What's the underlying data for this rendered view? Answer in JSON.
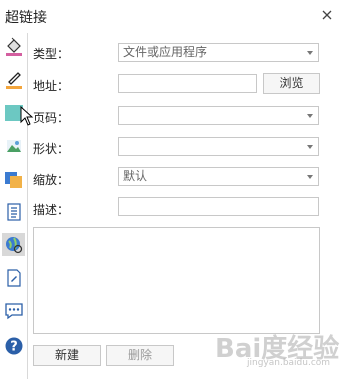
{
  "dialog": {
    "title": "超链接"
  },
  "form": {
    "type_label": "类型：",
    "type_value": "文件或应用程序",
    "address_label": "地址：",
    "address_value": "",
    "browse_label": "浏览",
    "page_label": "页码：",
    "page_value": "",
    "shape_label": "形状：",
    "shape_value": "",
    "zoom_label": "缩放：",
    "zoom_value": "默认",
    "desc_label": "描述：",
    "desc_value": ""
  },
  "buttons": {
    "new_label": "新建",
    "delete_label": "删除"
  },
  "watermark": {
    "text": "Bai度经验",
    "sub": "jingyan.baidu.com"
  },
  "sidebar": {
    "icons": [
      "paint-bucket-icon",
      "pen-line-icon",
      "square-fill-icon",
      "picture-icon",
      "layers-icon",
      "document-list-icon",
      "globe-link-icon",
      "note-icon",
      "comment-icon",
      "help-icon"
    ]
  }
}
